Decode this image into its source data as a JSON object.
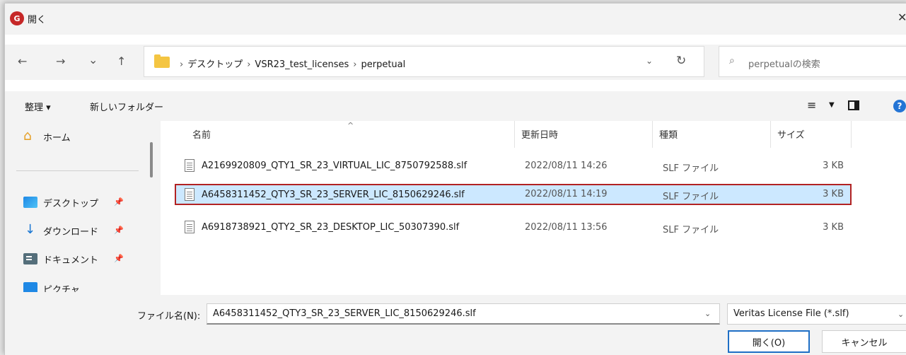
{
  "window": {
    "title": "開く",
    "app_icon_letter": "G"
  },
  "nav": {
    "back_glyph": "←",
    "forward_glyph": "→",
    "recent_glyph": "⌄",
    "up_glyph": "↑",
    "breadcrumbs": [
      "デスクトップ",
      "VSR23_test_licenses",
      "perpetual"
    ],
    "search_placeholder": "perpetualの検索"
  },
  "toolbar": {
    "organize": "整理 ▾",
    "new_folder": "新しいフォルダー"
  },
  "sidebar": {
    "items": [
      {
        "label": "ホーム"
      },
      {
        "label": "デスクトップ"
      },
      {
        "label": "ダウンロード"
      },
      {
        "label": "ドキュメント"
      },
      {
        "label": "ピクチャ"
      }
    ]
  },
  "columns": {
    "name": "名前",
    "modified": "更新日時",
    "type": "種類",
    "size": "サイズ"
  },
  "files": [
    {
      "name": "A2169920809_QTY1_SR_23_VIRTUAL_LIC_8750792588.slf",
      "modified": "2022/08/11 14:26",
      "type": "SLF ファイル",
      "size": "3 KB"
    },
    {
      "name": "A6458311452_QTY3_SR_23_SERVER_LIC_8150629246.slf",
      "modified": "2022/08/11 14:19",
      "type": "SLF ファイル",
      "size": "3 KB",
      "selected": true
    },
    {
      "name": "A6918738921_QTY2_SR_23_DESKTOP_LIC_50307390.slf",
      "modified": "2022/08/11 13:56",
      "type": "SLF ファイル",
      "size": "3 KB"
    }
  ],
  "footer": {
    "filename_label": "ファイル名(N):",
    "filename_value": "A6458311452_QTY3_SR_23_SERVER_LIC_8150629246.slf",
    "filter": "Veritas License File (*.slf)",
    "open_button": "開く(O)",
    "cancel_button": "キャンセル"
  },
  "colors": {
    "selection": "#cce8ff",
    "highlight_border": "#b22222",
    "accent": "#1f6fc5",
    "folder": "#f4c542"
  }
}
